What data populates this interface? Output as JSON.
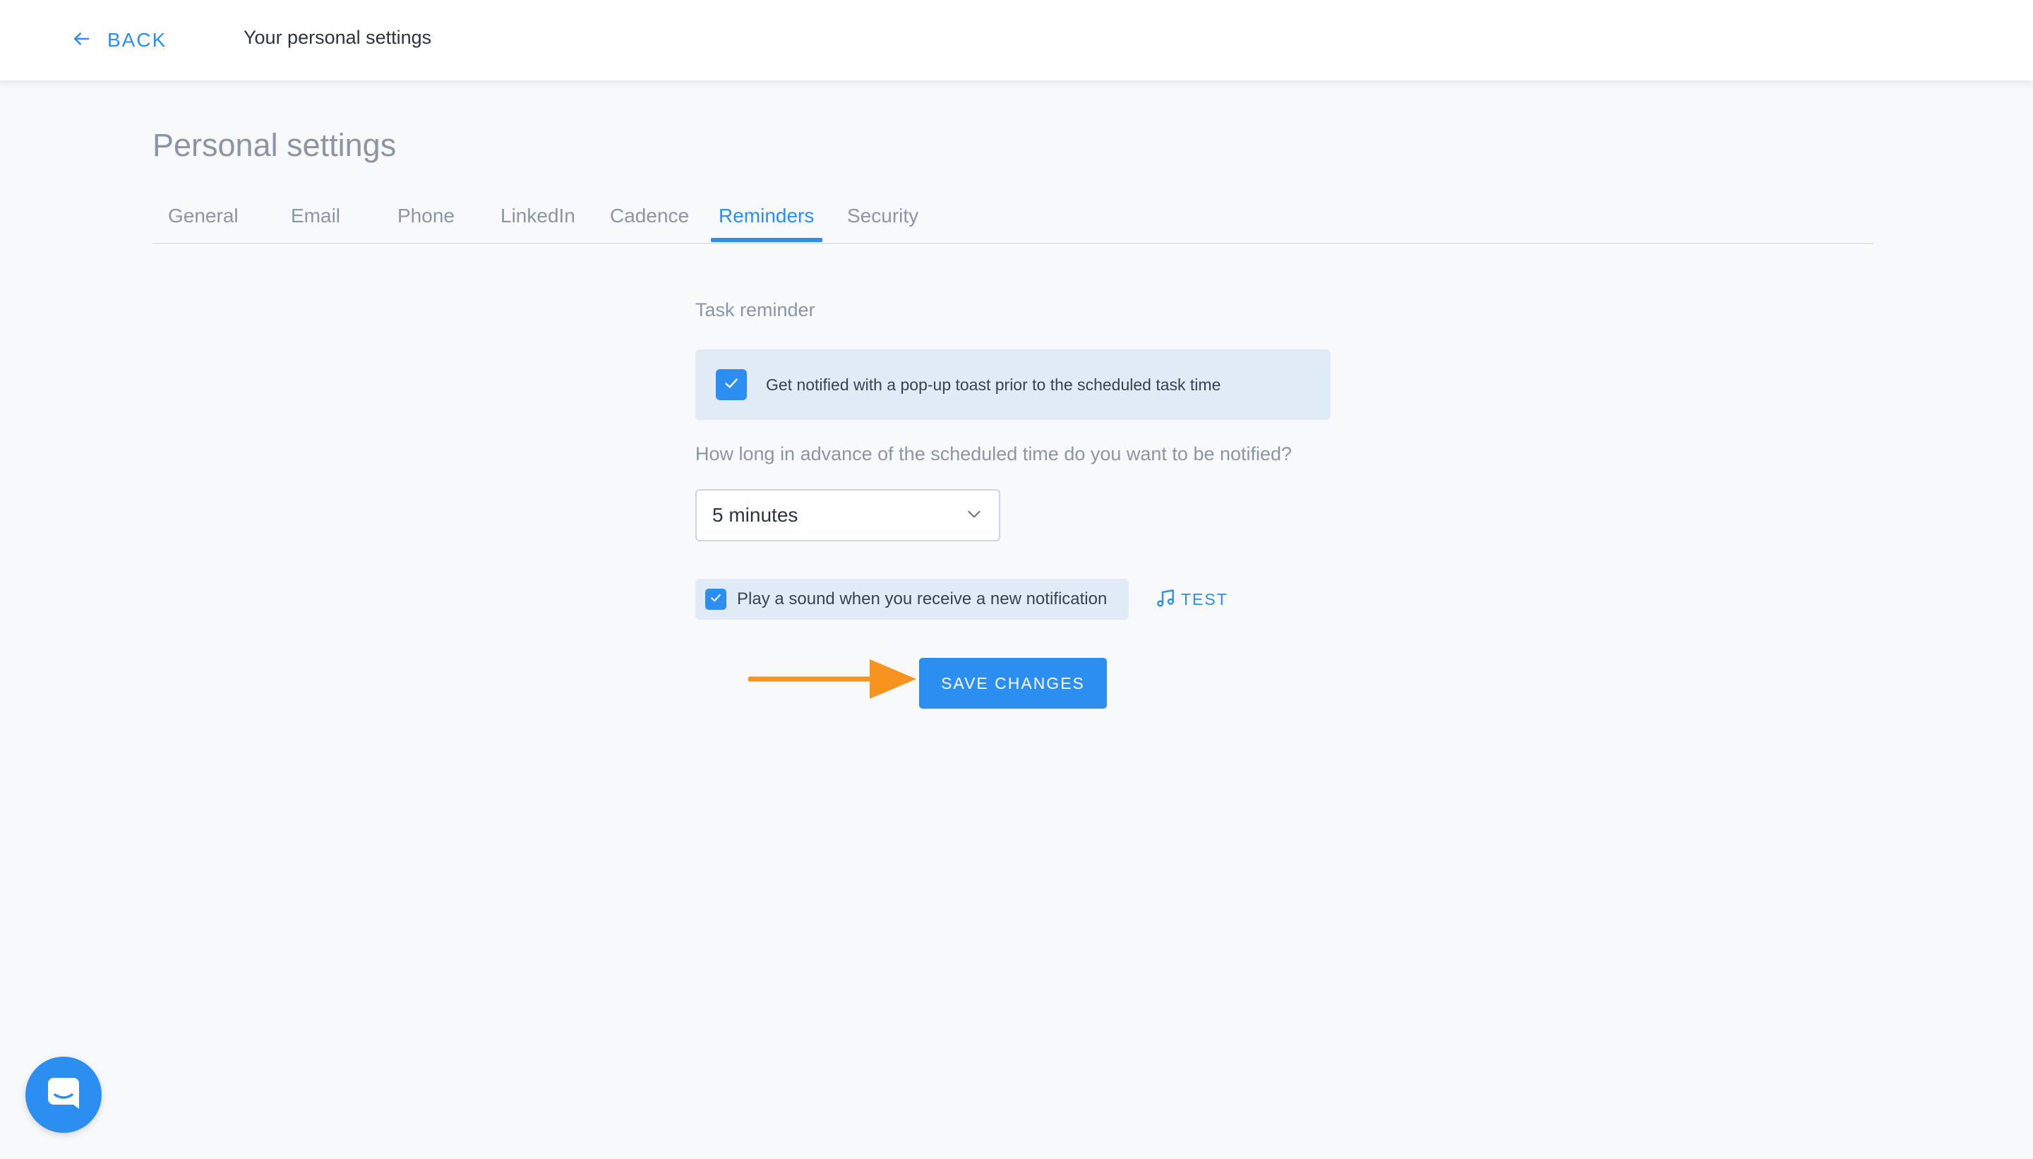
{
  "header": {
    "back_label": "BACK",
    "title": "Your personal settings"
  },
  "page": {
    "title": "Personal settings"
  },
  "tabs": [
    {
      "label": "General",
      "active": false
    },
    {
      "label": "Email",
      "active": false
    },
    {
      "label": "Phone",
      "active": false
    },
    {
      "label": "LinkedIn",
      "active": false
    },
    {
      "label": "Cadence",
      "active": false
    },
    {
      "label": "Reminders",
      "active": true
    },
    {
      "label": "Security",
      "active": false
    }
  ],
  "reminders": {
    "section_label": "Task reminder",
    "notify_checkbox": {
      "label": "Get notified with a pop-up toast prior to the scheduled task time",
      "checked": true
    },
    "advance_question": "How long in advance of the scheduled time do you want to be notified?",
    "advance_select": {
      "value": "5 minutes"
    },
    "sound_checkbox": {
      "label": "Play a sound when you receive a new notification",
      "checked": true
    },
    "test_label": "TEST",
    "save_label": "SAVE CHANGES"
  },
  "icons": {
    "back": "arrow-left-icon",
    "check": "check-icon",
    "dropdown": "chevron-down-icon",
    "test": "music-note-icon",
    "chat": "chat-icon"
  },
  "colors": {
    "accent": "#2b8ef0",
    "highlight_box": "#e1ebf6",
    "annotation_arrow": "#f7931e",
    "page_background": "#f8f9fb"
  }
}
